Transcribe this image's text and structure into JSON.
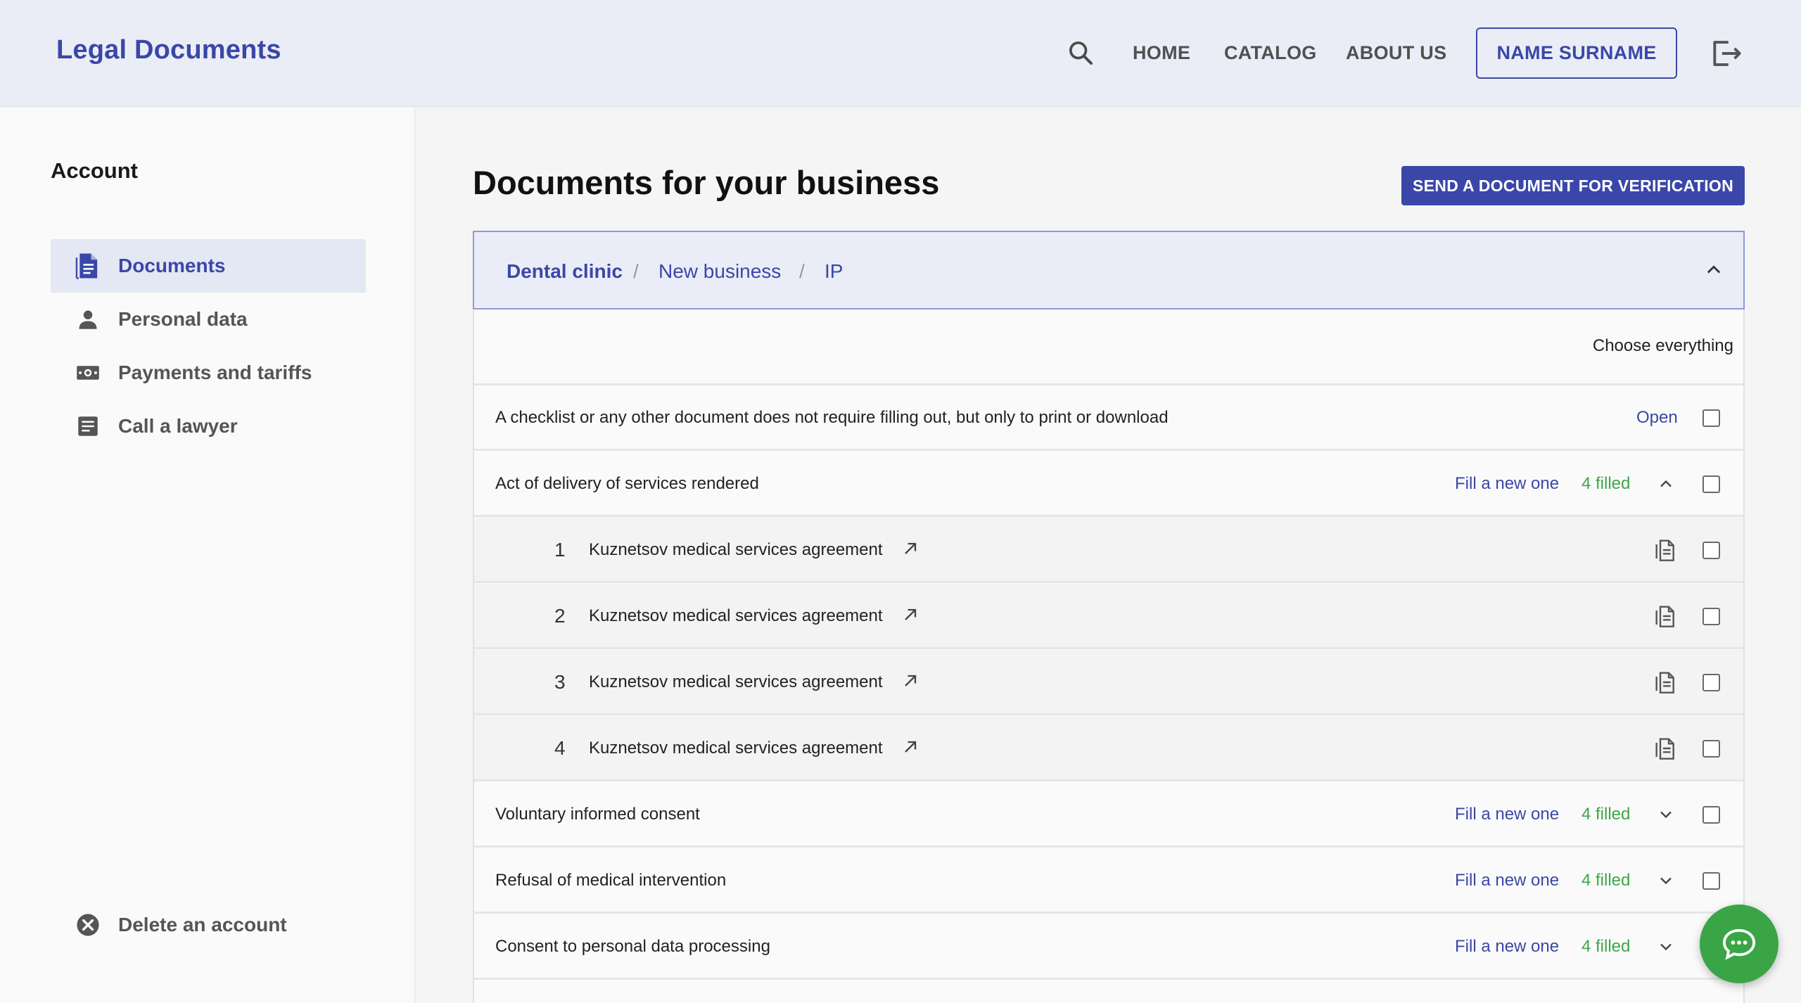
{
  "header": {
    "logo": "Legal Documents",
    "nav": [
      "HOME",
      "CATALOG",
      "ABOUT US"
    ],
    "user_button": "NAME SURNAME",
    "icons": {
      "search": "search-icon",
      "logout": "logout-icon"
    }
  },
  "sidebar": {
    "title": "Account",
    "items": [
      {
        "label": "Documents",
        "icon": "document-icon",
        "active": true
      },
      {
        "label": "Personal data",
        "icon": "person-icon",
        "active": false
      },
      {
        "label": "Payments and tariffs",
        "icon": "money-icon",
        "active": false
      },
      {
        "label": "Call a lawyer",
        "icon": "notes-icon",
        "active": false
      }
    ],
    "delete_account": "Delete an account"
  },
  "main": {
    "title": "Documents for your business",
    "verify_button": "SEND A DOCUMENT FOR VERIFICATION",
    "breadcrumb": [
      "Dental clinic",
      "New business",
      "IP"
    ],
    "choose_all": "Choose everything",
    "rows": [
      {
        "title": "A checklist or any other document does not require filling out, but only to print or download",
        "action": "Open"
      },
      {
        "title": "Act of delivery of services rendered",
        "action": "Fill a new one",
        "filled": "4 filled",
        "expanded": true
      },
      {
        "number": "1",
        "title": "Kuznetsov medical services agreement"
      },
      {
        "number": "2",
        "title": "Kuznetsov medical services agreement"
      },
      {
        "number": "3",
        "title": "Kuznetsov medical services agreement"
      },
      {
        "number": "4",
        "title": "Kuznetsov medical services agreement"
      },
      {
        "title": "Voluntary informed consent",
        "action": "Fill a new one",
        "filled": "4 filled",
        "expanded": false
      },
      {
        "title": "Refusal of medical intervention",
        "action": "Fill a new one",
        "filled": "4 filled",
        "expanded": false
      },
      {
        "title": "Consent to personal data processing",
        "action": "Fill a new one",
        "filled": "4 filled",
        "expanded": false
      }
    ]
  },
  "colors": {
    "accent": "#3a47a8",
    "filled": "#3fa64a",
    "chat": "#3aa546"
  }
}
